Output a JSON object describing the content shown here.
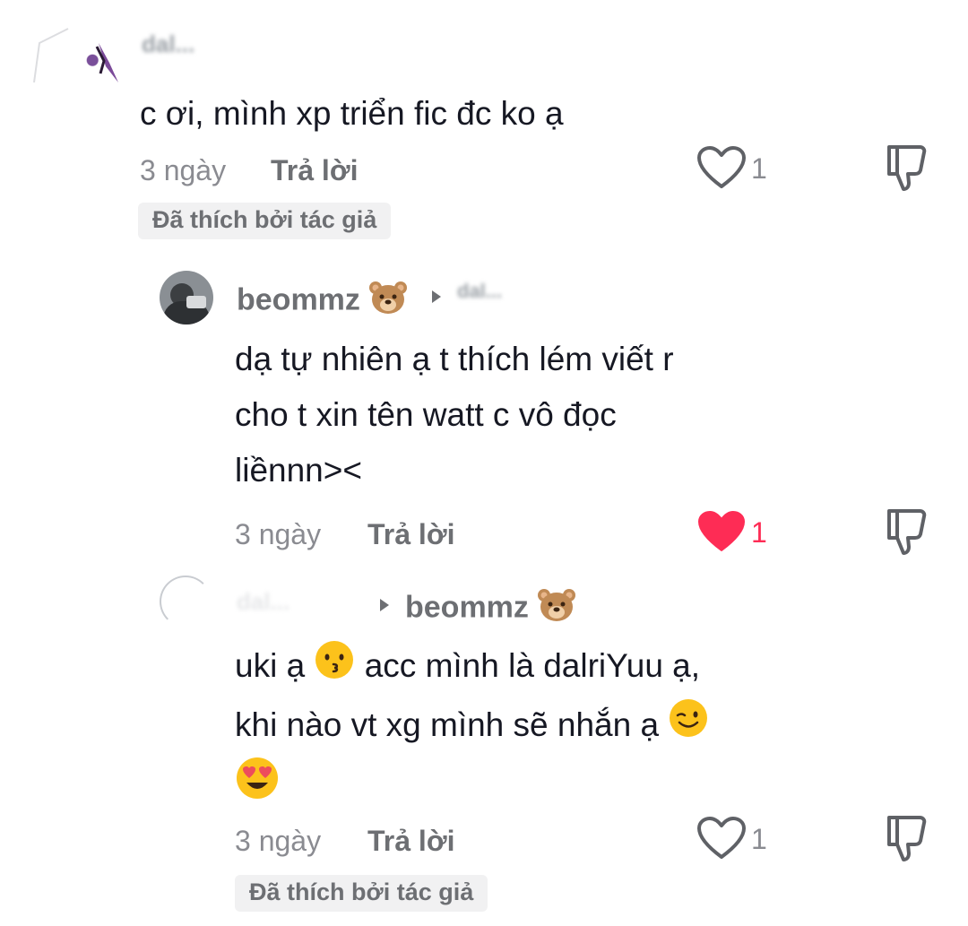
{
  "comments": [
    {
      "username": "dal...",
      "text": "c ơi, mình xp triển fic đc ko ạ",
      "time": "3 ngày",
      "reply": "Trả lời",
      "likes": "1",
      "liked": false,
      "badge": "Đã thích bởi tác giả",
      "icons": {
        "like": "heart-outline-icon",
        "dislike": "thumbs-down-icon"
      }
    },
    {
      "username": "beommz",
      "username_emoji": "bear-face-emoji",
      "reply_to": "dal...",
      "text_lines": [
        "dạ tự nhiên ạ t thích lém viết r",
        "cho t xin tên watt c vô đọc",
        "liềnnn><"
      ],
      "time": "3 ngày",
      "reply": "Trả lời",
      "likes": "1",
      "liked": true,
      "icons": {
        "like": "heart-filled-icon",
        "dislike": "thumbs-down-icon"
      }
    },
    {
      "username": "dal...",
      "reply_to": "beommz",
      "reply_to_emoji": "bear-face-emoji",
      "text_lines": [
        "uki ạ",
        "acc mình là dalriYuu ạ,",
        "khi nào vt xg mình sẽ nhắn ạ",
        ""
      ],
      "inline_emojis": [
        "kissing-face-emoji",
        "winking-face-emoji",
        "heart-eyes-emoji"
      ],
      "time": "3 ngày",
      "reply": "Trả lời",
      "likes": "1",
      "liked": false,
      "badge": "Đã thích bởi tác giả",
      "icons": {
        "like": "heart-outline-icon",
        "dislike": "thumbs-down-icon"
      }
    }
  ],
  "colors": {
    "text": "#161823",
    "secondary": "#8a8b91",
    "liked": "#fe2c55",
    "badge_bg": "#f1f1f2"
  }
}
